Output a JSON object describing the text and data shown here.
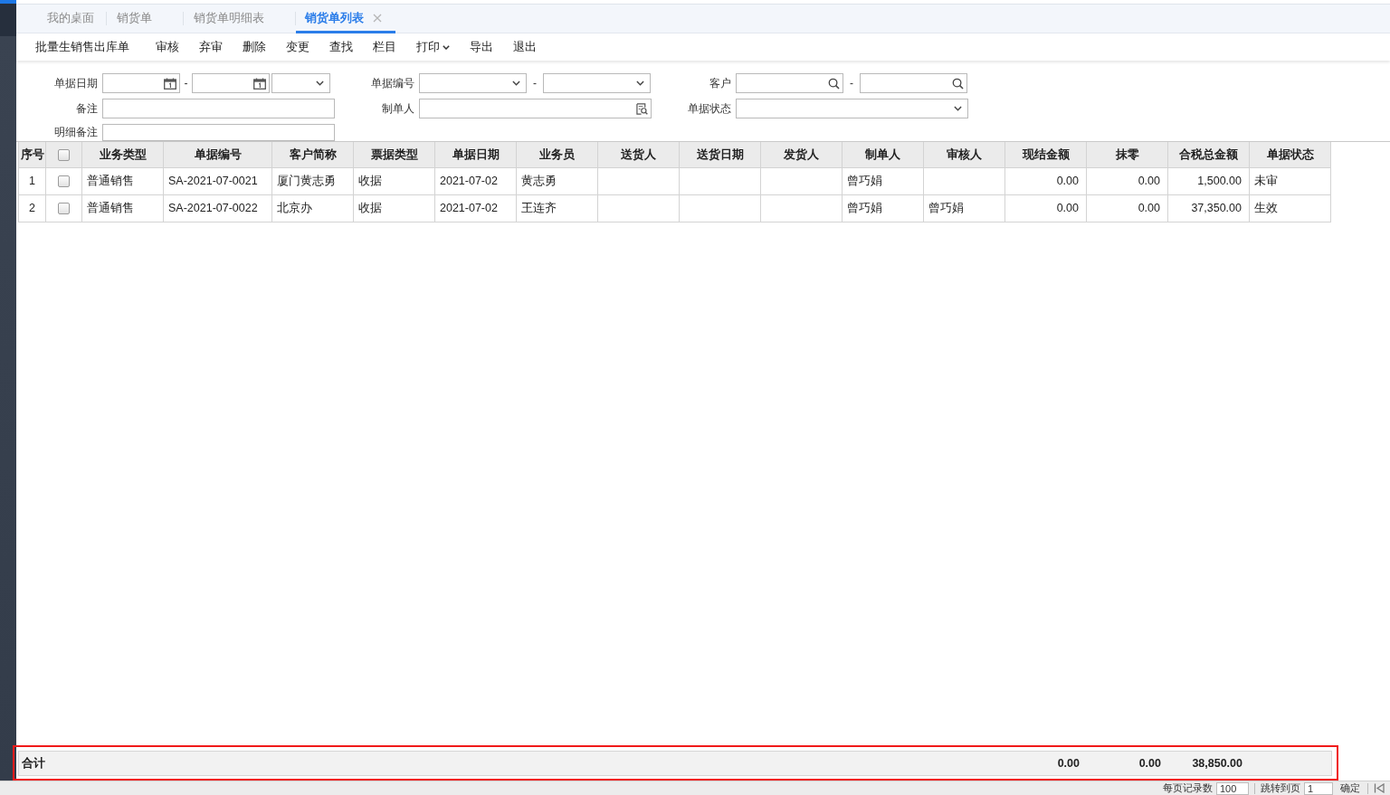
{
  "tabs": [
    {
      "label": "我的桌面",
      "selected": false,
      "closable": false
    },
    {
      "label": "销货单",
      "selected": false,
      "closable": false
    },
    {
      "label": "销货单明细表",
      "selected": false,
      "closable": false
    },
    {
      "label": "销货单列表",
      "selected": true,
      "closable": true
    }
  ],
  "toolbar": [
    {
      "label": "批量生销售出库单",
      "kind": "button"
    },
    {
      "label": "审核",
      "kind": "button"
    },
    {
      "label": "弃审",
      "kind": "button"
    },
    {
      "label": "删除",
      "kind": "button"
    },
    {
      "label": "变更",
      "kind": "button"
    },
    {
      "label": "查找",
      "kind": "button"
    },
    {
      "label": "栏目",
      "kind": "button"
    },
    {
      "label": "打印",
      "kind": "menu"
    },
    {
      "label": "导出",
      "kind": "button"
    },
    {
      "label": "退出",
      "kind": "button"
    }
  ],
  "filters": [
    {
      "label": "单据日期",
      "kind": "date_range",
      "separator": "-"
    },
    {
      "label": "单据编号",
      "kind": "select_range",
      "separator": "-"
    },
    {
      "label": "客户",
      "kind": "search_range",
      "separator": "-"
    },
    {
      "label": "备注",
      "kind": "text"
    },
    {
      "label": "制单人",
      "kind": "lookup"
    },
    {
      "label": "单据状态",
      "kind": "select"
    },
    {
      "label": "明细备注",
      "kind": "text"
    }
  ],
  "table": {
    "index_column": "序号",
    "select_all": {
      "checked": false
    },
    "columns": [
      {
        "label": "业务类型",
        "kind": "text"
      },
      {
        "label": "单据编号",
        "kind": "code"
      },
      {
        "label": "客户简称",
        "kind": "text"
      },
      {
        "label": "票据类型",
        "kind": "text"
      },
      {
        "label": "单据日期",
        "kind": "text"
      },
      {
        "label": "业务员",
        "kind": "text"
      },
      {
        "label": "送货人",
        "kind": "text"
      },
      {
        "label": "送货日期",
        "kind": "text"
      },
      {
        "label": "发货人",
        "kind": "text"
      },
      {
        "label": "制单人",
        "kind": "text"
      },
      {
        "label": "审核人",
        "kind": "text"
      },
      {
        "label": "现结金额",
        "kind": "number",
        "total": "0.00"
      },
      {
        "label": "抹零",
        "kind": "number",
        "total": "0.00"
      },
      {
        "label": "合税总金额",
        "kind": "number",
        "total": "38,850.00"
      },
      {
        "label": "单据状态",
        "kind": "text"
      }
    ],
    "rows": [
      {
        "index": "1",
        "checked": false,
        "cells": [
          "普通销售",
          "SA-2021-07-0021",
          "厦门黄志勇",
          "收据",
          "2021-07-02",
          "黄志勇",
          null,
          null,
          null,
          "曾巧娟",
          null,
          "0.00",
          "0.00",
          "1,500.00",
          "未审"
        ]
      },
      {
        "index": "2",
        "checked": false,
        "cells": [
          "普通销售",
          "SA-2021-07-0022",
          "北京办",
          "收据",
          "2021-07-02",
          "王连齐",
          null,
          null,
          null,
          "曾巧娟",
          "曾巧娟",
          "0.00",
          "0.00",
          "37,350.00",
          "生效"
        ]
      }
    ],
    "summary": {
      "label": "合计",
      "highlighted": true
    }
  },
  "pager": {
    "page_size_label": "每页记录数",
    "page_size": "100",
    "jump_label": "跳转到页",
    "page": "1",
    "confirm": "确定"
  }
}
